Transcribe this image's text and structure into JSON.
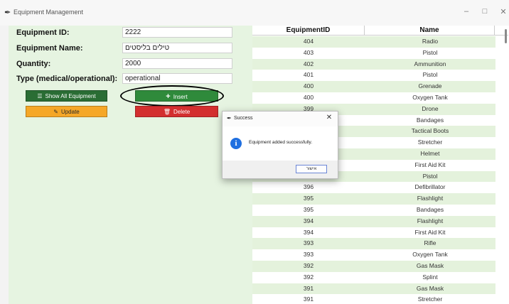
{
  "window": {
    "title": "Equipment Management",
    "controls": {
      "minimize": "–",
      "maximize": "□",
      "close": "✕"
    }
  },
  "form": {
    "labels": {
      "id": "Equipment ID:",
      "name": "Equipment Name:",
      "quantity": "Quantity:",
      "type": "Type (medical/operational):"
    },
    "values": {
      "id": "2222",
      "name": "טילים בליסטים",
      "quantity": "2000",
      "type": "operational"
    }
  },
  "buttons": {
    "show_all": "Show All Equipment",
    "insert": "Insert",
    "update": "Update",
    "delete": "Delete"
  },
  "table": {
    "headers": {
      "id": "EquipmentID",
      "name": "Name"
    },
    "rows": [
      {
        "id": "404",
        "name": "Radio"
      },
      {
        "id": "403",
        "name": "Pistol"
      },
      {
        "id": "402",
        "name": "Ammunition"
      },
      {
        "id": "401",
        "name": "Pistol"
      },
      {
        "id": "400",
        "name": "Grenade"
      },
      {
        "id": "400",
        "name": "Oxygen Tank"
      },
      {
        "id": "399",
        "name": "Drone"
      },
      {
        "id": "",
        "name": "Bandages"
      },
      {
        "id": "",
        "name": "Tactical Boots"
      },
      {
        "id": "",
        "name": "Stretcher"
      },
      {
        "id": "",
        "name": "Helmet"
      },
      {
        "id": "",
        "name": "First Aid Kit"
      },
      {
        "id": "",
        "name": "Pistol"
      },
      {
        "id": "396",
        "name": "Defibrillator"
      },
      {
        "id": "395",
        "name": "Flashlight"
      },
      {
        "id": "395",
        "name": "Bandages"
      },
      {
        "id": "394",
        "name": "Flashlight"
      },
      {
        "id": "394",
        "name": "First Aid Kit"
      },
      {
        "id": "393",
        "name": "Rifle"
      },
      {
        "id": "393",
        "name": "Oxygen Tank"
      },
      {
        "id": "392",
        "name": "Gas Mask"
      },
      {
        "id": "392",
        "name": "Splint"
      },
      {
        "id": "391",
        "name": "Gas Mask"
      },
      {
        "id": "391",
        "name": "Stretcher"
      }
    ]
  },
  "dialog": {
    "title": "Success",
    "message": "Equipment added successfully.",
    "ok_label": "אישור",
    "icon": "info-icon"
  }
}
